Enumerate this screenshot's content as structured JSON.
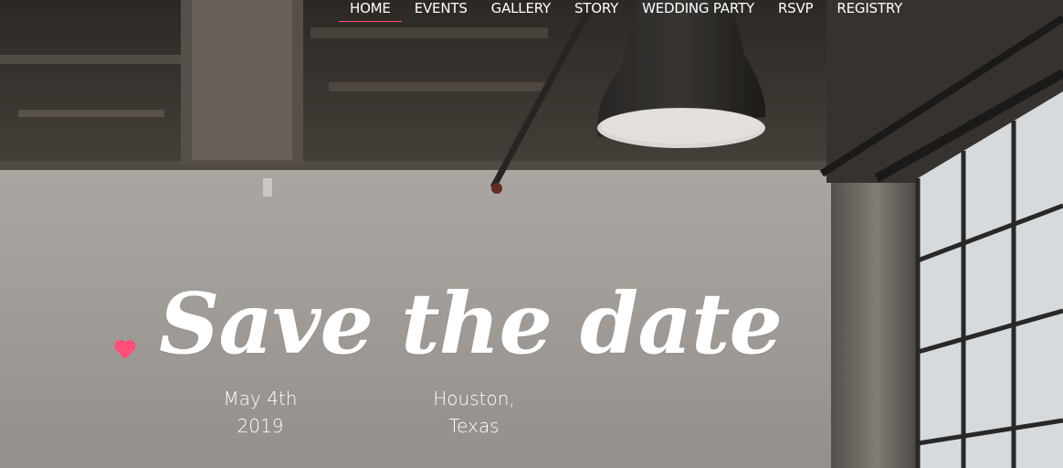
{
  "nav": {
    "items": [
      {
        "label": "HOME",
        "active": true
      },
      {
        "label": "EVENTS",
        "active": false
      },
      {
        "label": "GALLERY",
        "active": false
      },
      {
        "label": "STORY",
        "active": false
      },
      {
        "label": "WEDDING PARTY",
        "active": false
      },
      {
        "label": "RSVP",
        "active": false
      },
      {
        "label": "REGISTRY",
        "active": false
      }
    ]
  },
  "hero": {
    "title": "Save the date",
    "date_line1": "May 4th",
    "date_line2": "2019",
    "place_line1": "Houston,",
    "place_line2": "Texas",
    "heart_icon": "heart-icon"
  },
  "colors": {
    "accent": "#ff4f7b",
    "text": "#ffffff"
  }
}
